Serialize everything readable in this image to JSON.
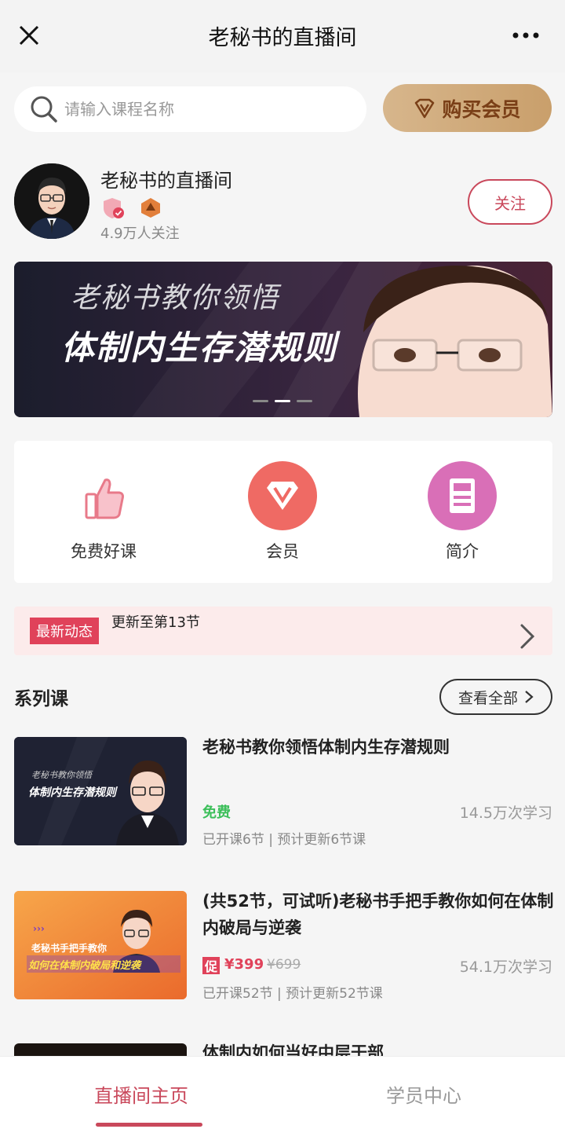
{
  "header": {
    "title": "老秘书的直播间"
  },
  "search": {
    "placeholder": "请输入课程名称"
  },
  "vip_button": {
    "label": "购买会员"
  },
  "profile": {
    "name": "老秘书的直播间",
    "followers": "4.9万人关注",
    "follow_label": "关注"
  },
  "banner": {
    "line1": "老秘书教你领悟",
    "line2": "体制内生存潜规则",
    "active_slide": 2,
    "total_slides": 3
  },
  "entries": [
    {
      "label": "免费好课",
      "icon": "thumbs-up-icon"
    },
    {
      "label": "会员",
      "icon": "vip-diamond-icon"
    },
    {
      "label": "简介",
      "icon": "document-icon"
    }
  ],
  "news": {
    "tag": "最新动态",
    "text": "更新至第13节"
  },
  "section": {
    "title": "系列课",
    "view_all": "查看全部"
  },
  "courses": [
    {
      "title": "老秘书教你领悟体制内生存潜规则",
      "price": "免费",
      "learners": "14.5万次学习",
      "meta": "已开课6节 | 预计更新6节课",
      "thumb_line1": "老秘书教你领悟",
      "thumb_line2": "体制内生存潜规则"
    },
    {
      "title": "(共52节，可试听)老秘书手把手教你如何在体制内破局与逆袭",
      "promo_tag": "促",
      "price_now": "¥399",
      "price_old": "¥699",
      "learners": "54.1万次学习",
      "meta": "已开课52节 | 预计更新52节课",
      "thumb_line1": "老秘书手把手教你",
      "thumb_line2": "如何在体制内破局和逆袭"
    },
    {
      "title": "体制内如何当好中层干部"
    }
  ],
  "tabs": [
    {
      "label": "直播间主页",
      "active": true
    },
    {
      "label": "学员中心",
      "active": false
    }
  ],
  "colors": {
    "accent": "#c9485b",
    "tag_red": "#e0425a",
    "free_green": "#3cbf5a",
    "vip_gold": "#d7b68c",
    "vip_text": "#7a3f17"
  }
}
